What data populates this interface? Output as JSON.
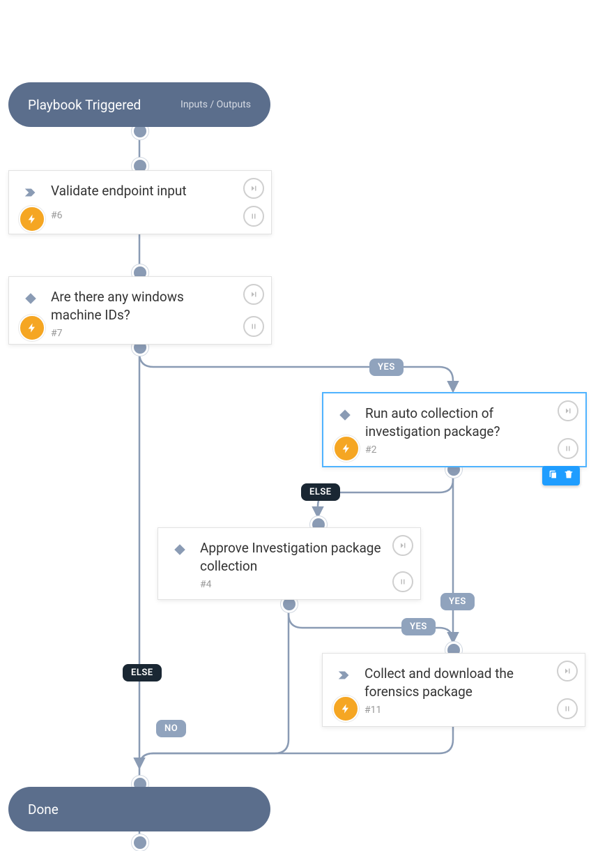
{
  "start": {
    "title": "Playbook Triggered",
    "sub": "Inputs / Outputs"
  },
  "end": {
    "title": "Done"
  },
  "nodes": {
    "n6": {
      "label": "Validate endpoint input",
      "id": "#6",
      "type": "chevron",
      "bolt": true
    },
    "n7": {
      "label": "Are there any windows machine IDs?",
      "id": "#7",
      "type": "diamond",
      "bolt": true
    },
    "n2": {
      "label": "Run auto collection of investigation package?",
      "id": "#2",
      "type": "diamond",
      "bolt": true,
      "selected": true
    },
    "n4": {
      "label": "Approve Investigation package collection",
      "id": "#4",
      "type": "diamond",
      "bolt": false
    },
    "n11": {
      "label": "Collect and download the forensics package",
      "id": "#11",
      "type": "chevron",
      "bolt": true
    }
  },
  "branches": {
    "b_yes1": "YES",
    "b_else1": "ELSE",
    "b_yes2": "YES",
    "b_yes3": "YES",
    "b_else2": "ELSE",
    "b_no": "NO"
  }
}
